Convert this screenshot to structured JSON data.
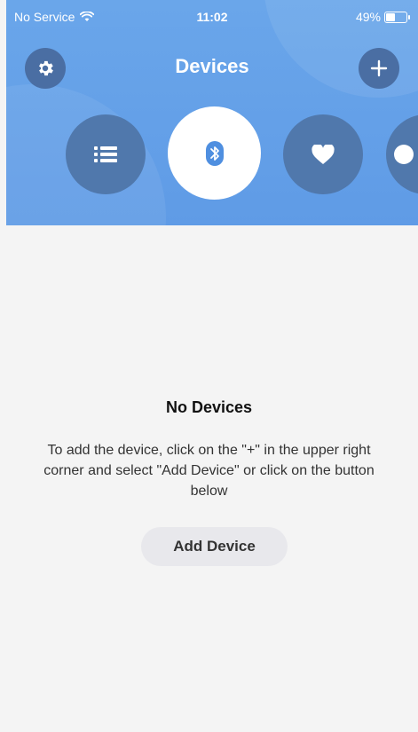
{
  "status_bar": {
    "carrier": "No Service",
    "time": "11:02",
    "battery": "49%",
    "battery_level": 0.49
  },
  "nav": {
    "title": "Devices",
    "left_icon": "gear-icon",
    "right_icon": "plus-icon"
  },
  "categories": [
    {
      "icon": "list-icon",
      "active": false
    },
    {
      "icon": "bluetooth-icon",
      "active": true
    },
    {
      "icon": "heart-icon",
      "active": false
    },
    {
      "icon": "partial-icon",
      "active": false
    }
  ],
  "empty_state": {
    "title": "No Devices",
    "description": "To add the device, click on the \"+\" in the upper right corner and select \"Add Device\" or click on the button below",
    "button_label": "Add Device"
  },
  "colors": {
    "header_gradient_top": "#6aa6ea",
    "header_gradient_bottom": "#5f9be6",
    "circle_button": "#4a6ea3",
    "bluetooth_accent": "#4f8fe0",
    "background": "#f4f4f4"
  }
}
